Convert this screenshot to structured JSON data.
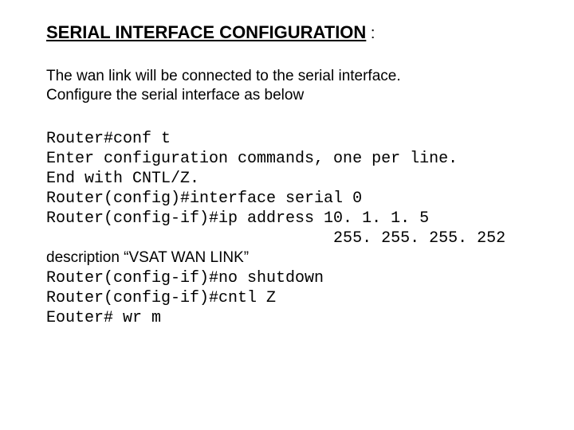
{
  "heading": {
    "title": "SERIAL INTERFACE CONFIGURATION",
    "colon": " :"
  },
  "intro": {
    "line1": "The wan link will be connected to the serial interface.",
    "line2": "Configure the serial interface as below"
  },
  "config": {
    "l1": "Router#conf t",
    "l2": "Enter configuration commands, one per line.",
    "l3": "End with CNTL/Z.",
    "l4": "Router(config)#interface serial 0",
    "l5": "Router(config-if)#ip address 10. 1. 1. 5",
    "l6": "                              255. 255. 255. 252",
    "l7": "description “VSAT WAN LINK”",
    "l8": "Router(config-if)#no shutdown",
    "l9": "Router(config-if)#cntl Z",
    "l10": "Eouter# wr m"
  }
}
